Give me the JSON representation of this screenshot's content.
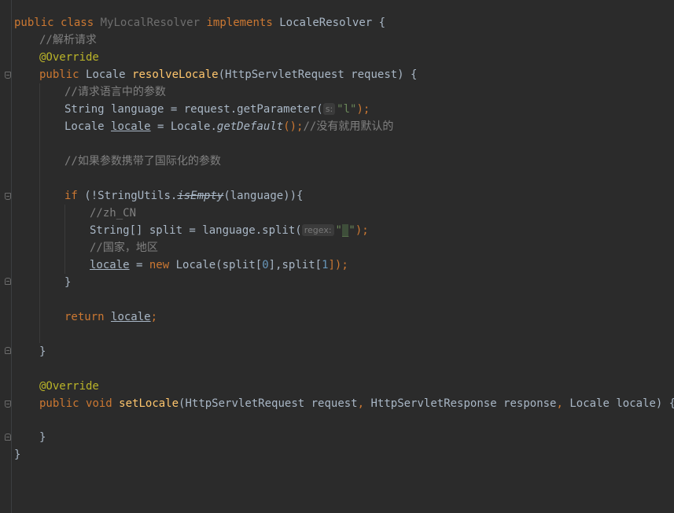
{
  "code": {
    "l1": {
      "kw_public": "public",
      "kw_class": "class",
      "class_name": "MyLocalResolver",
      "kw_implements": "implements",
      "iface": "LocaleResolver",
      "brace": "{"
    },
    "l2": {
      "comment": "//解析请求"
    },
    "l3": {
      "annotation": "@Override"
    },
    "l4": {
      "kw_public": "public",
      "ret_type": "Locale",
      "method": "resolveLocale",
      "params": "(HttpServletRequest request) {"
    },
    "l5": {
      "comment": "//请求语言中的参数"
    },
    "l6": {
      "pre": "String language = request.getParameter(",
      "hint": "s:",
      "str": "\"l\"",
      "post": ");"
    },
    "l7": {
      "type": "Locale",
      "var": "locale",
      "mid": " = Locale.",
      "call": "getDefault",
      "post": "();",
      "comment": "//没有就用默认的"
    },
    "l8": {
      "comment": "//如果参数携带了国际化的参数"
    },
    "l9": {
      "kw_if": "if",
      "pre": "(!StringUtils.",
      "call": "isEmpty",
      "post": "(language)){"
    },
    "l10": {
      "comment": "//zh_CN"
    },
    "l11": {
      "pre": "String[] split = language.split(",
      "hint": "regex:",
      "q1": "\"",
      "us": "_",
      "q2": "\"",
      "post": ");"
    },
    "l12": {
      "comment": "//国家，地区"
    },
    "l13": {
      "var": "locale",
      "mid": " = ",
      "kw_new": "new",
      "call": " Locale(split[",
      "n0": "0",
      "mid2": "],split[",
      "n1": "1",
      "end": "]);"
    },
    "l14": {
      "brace": "}"
    },
    "l15": {
      "kw_return": "return",
      "var": "locale",
      "semi": ";"
    },
    "l16": {
      "brace": "}"
    },
    "l17": {
      "annotation": "@Override"
    },
    "l18": {
      "kw_public": "public",
      "kw_void": "void",
      "method": "setLocale",
      "params1": "(HttpServletRequest request",
      "comma1": ",",
      "params2": " HttpServletResponse response",
      "comma2": ",",
      "params3": " Locale locale) {"
    },
    "l19": {
      "brace": "}"
    },
    "l20": {
      "brace": "}"
    }
  },
  "colors": {
    "background": "#2b2b2b",
    "default_text": "#a9b7c6",
    "keyword": "#cc7832",
    "annotation": "#bbb529",
    "method_decl": "#ffc66d",
    "comment": "#808080",
    "string": "#6a8759",
    "number": "#6897bb"
  }
}
